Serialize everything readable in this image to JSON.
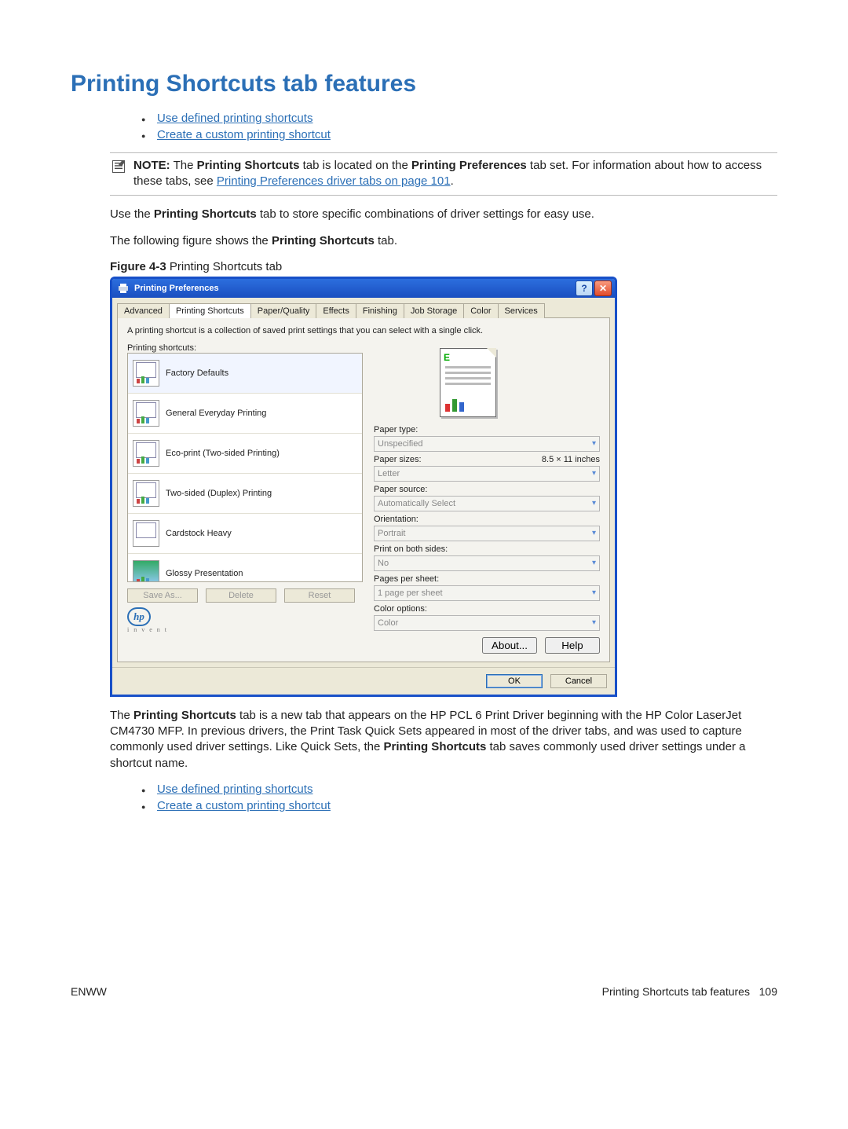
{
  "heading": "Printing Shortcuts tab features",
  "toc": [
    "Use defined printing shortcuts",
    "Create a custom printing shortcut"
  ],
  "note": {
    "prefix": "NOTE:",
    "part1": "The ",
    "bold1": "Printing Shortcuts",
    "part2": " tab is located on the ",
    "bold2": "Printing Preferences",
    "part3": " tab set. For information about how to access these tabs, see ",
    "link": "Printing Preferences driver tabs on page 101",
    "part4": "."
  },
  "para1a": "Use the ",
  "para1b": "Printing Shortcuts",
  "para1c": " tab to store specific combinations of driver settings for easy use.",
  "para2a": "The following figure shows the ",
  "para2b": "Printing Shortcuts",
  "para2c": " tab.",
  "figure_label": "Figure 4-3",
  "figure_caption": "  Printing Shortcuts tab",
  "dialog": {
    "title": "Printing Preferences",
    "tabs": [
      "Advanced",
      "Printing Shortcuts",
      "Paper/Quality",
      "Effects",
      "Finishing",
      "Job Storage",
      "Color",
      "Services"
    ],
    "active_tab_index": 1,
    "description": "A printing shortcut is a collection of saved print settings that you can select with a single click.",
    "list_label": "Printing shortcuts:",
    "shortcuts": [
      "Factory Defaults",
      "General Everyday Printing",
      "Eco-print (Two-sided Printing)",
      "Two-sided (Duplex) Printing",
      "Cardstock Heavy",
      "Glossy Presentation"
    ],
    "buttons": {
      "save_as": "Save As...",
      "delete": "Delete",
      "reset": "Reset"
    },
    "fields": {
      "paper_type": {
        "label": "Paper type:",
        "value": "Unspecified"
      },
      "paper_sizes": {
        "label": "Paper sizes:",
        "hint": "8.5 × 11 inches",
        "value": "Letter"
      },
      "paper_source": {
        "label": "Paper source:",
        "value": "Automatically Select"
      },
      "orientation": {
        "label": "Orientation:",
        "value": "Portrait"
      },
      "both_sides": {
        "label": "Print on both sides:",
        "value": "No"
      },
      "pages_per_sheet": {
        "label": "Pages per sheet:",
        "value": "1 page per sheet"
      },
      "color_options": {
        "label": "Color options:",
        "value": "Color"
      }
    },
    "about": "About...",
    "help": "Help",
    "hp_invent": "i n v e n t",
    "ok": "OK",
    "cancel": "Cancel"
  },
  "para3a": "The ",
  "para3b": "Printing Shortcuts",
  "para3c": " tab is a new tab that appears on the HP PCL 6 Print Driver beginning with the HP Color LaserJet CM4730 MFP. In previous drivers, the Print Task Quick Sets appeared in most of the driver tabs, and was used to capture commonly used driver settings. Like Quick Sets, the ",
  "para3d": "Printing Shortcuts",
  "para3e": " tab saves commonly used driver settings under a shortcut name.",
  "footer": {
    "left": "ENWW",
    "right_text": "Printing Shortcuts tab features",
    "page": "109"
  }
}
